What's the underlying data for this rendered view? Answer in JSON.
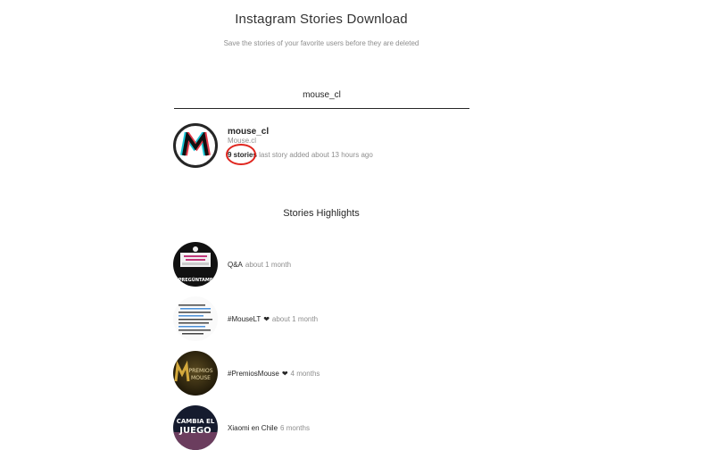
{
  "header": {
    "title": "Instagram Stories Download",
    "subtitle": "Save the stories of your favorite users before they are deleted"
  },
  "search": {
    "value": "mouse_cl"
  },
  "profile": {
    "username": "mouse_cl",
    "full_name": "Mouse.cl",
    "story_count": "9 stories",
    "last_story": "last story added about 13 hours ago"
  },
  "highlights": {
    "section_title": "Stories Highlights",
    "items": [
      {
        "title": "Q&A",
        "heart": "",
        "time": "about 1 month"
      },
      {
        "title": "#MouseLT",
        "heart": "❤",
        "time": "about 1 month"
      },
      {
        "title": "#PremiosMouse",
        "heart": "❤",
        "time": "4 months"
      },
      {
        "title": "Xiaomi en Chile",
        "heart": "",
        "time": "6 months"
      }
    ]
  },
  "thumb_text": {
    "qa": "PREGÚNTAME",
    "premios_top": "PREMIOS",
    "premios_bottom": "MOUSE",
    "xiaomi_line1": "CAMBIA EL",
    "xiaomi_line2": "JUEGO"
  },
  "colors": {
    "annotation_red": "#e0261f",
    "text_dark": "#262626",
    "text_muted": "#8e8e8e"
  },
  "icons": {
    "avatar": "mouse-logo-icon",
    "heart": "heart-icon"
  }
}
